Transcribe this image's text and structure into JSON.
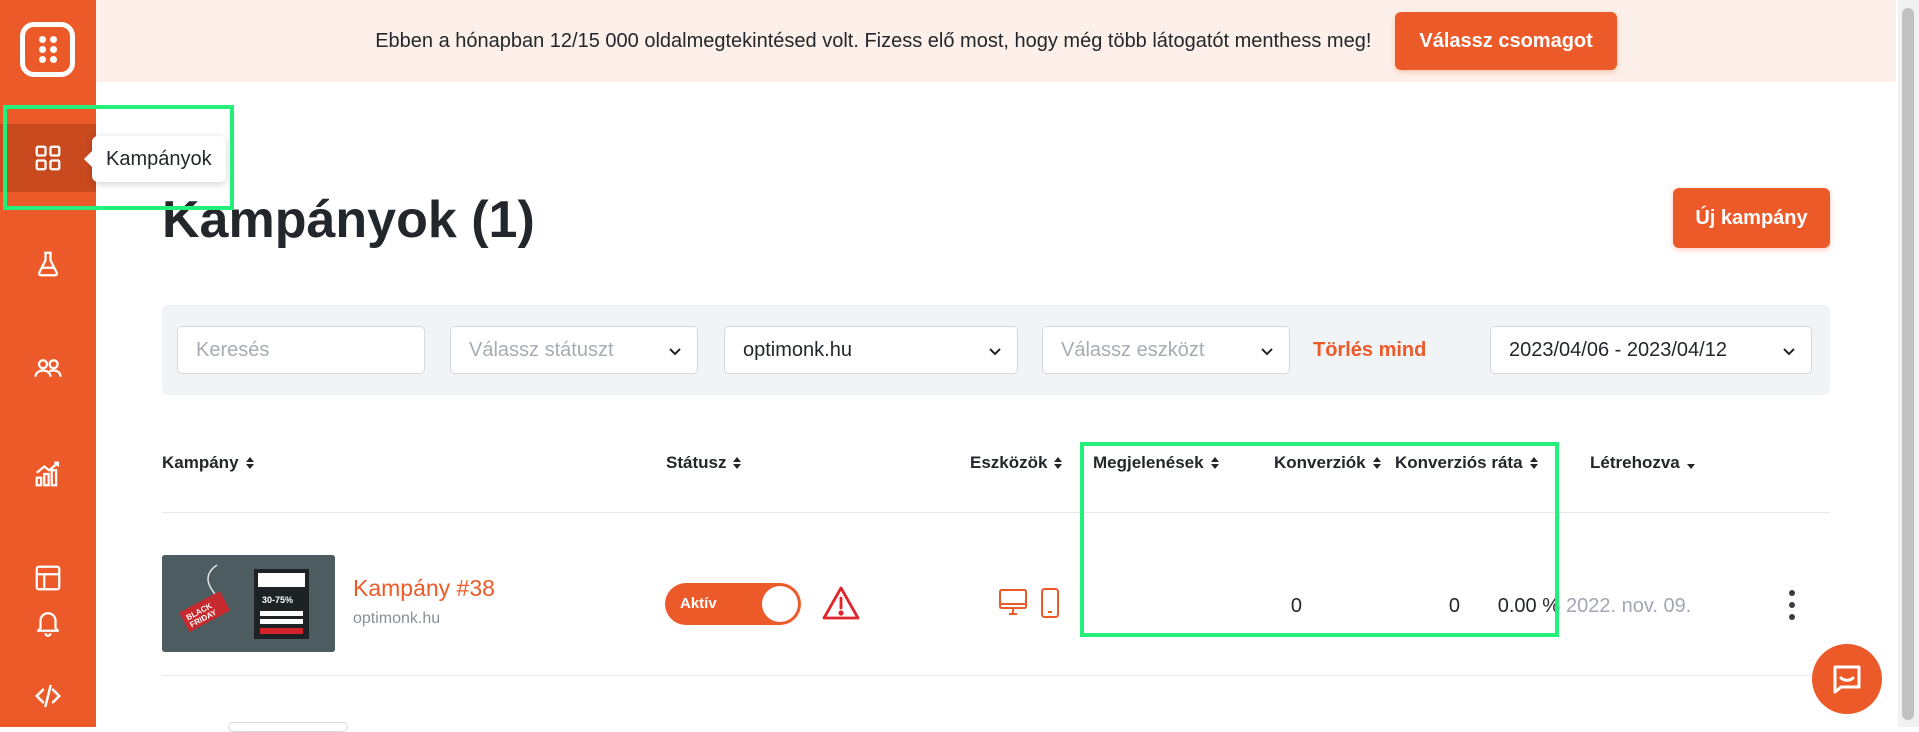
{
  "banner": {
    "message": "Ebben a hónapban 12/15 000 oldalmegtekintésed volt. Fizess elő most, hogy még több látogatót menthess meg!",
    "cta_label": "Válassz csomagot"
  },
  "sidebar": {
    "items": [
      {
        "icon": "grid-icon",
        "tooltip": "Kampányok",
        "active": true
      },
      {
        "icon": "flask-icon"
      },
      {
        "icon": "users-icon"
      },
      {
        "icon": "chart-icon"
      },
      {
        "icon": "layout-icon"
      },
      {
        "icon": "bell-icon"
      },
      {
        "icon": "code-icon"
      }
    ]
  },
  "tooltip": "Kampányok",
  "page": {
    "title": "Kampányok (1)",
    "new_button": "Új kampány"
  },
  "filters": {
    "search_placeholder": "Keresés",
    "status_placeholder": "Válassz státuszt",
    "domain_value": "optimonk.hu",
    "device_placeholder": "Válassz eszközt",
    "clear_all": "Törlés mind",
    "date_range": "2023/04/06 - 2023/04/12"
  },
  "table": {
    "headers": {
      "campaign": "Kampány",
      "status": "Státusz",
      "devices": "Eszközök",
      "impressions": "Megjelenések",
      "conversions": "Konverziók",
      "conversion_rate": "Konverziós ráta",
      "created": "Létrehozva"
    },
    "rows": [
      {
        "name": "Kampány #38",
        "domain": "optimonk.hu",
        "status_label": "Aktív",
        "impressions": "0",
        "conversions": "0",
        "conversion_rate": "0.00 %",
        "created": "2022. nov. 09."
      }
    ]
  },
  "colors": {
    "accent": "#ed5a29",
    "sidebar_active": "#c94a1f",
    "highlight": "#22f07a",
    "banner_bg": "#fdf0ea"
  }
}
